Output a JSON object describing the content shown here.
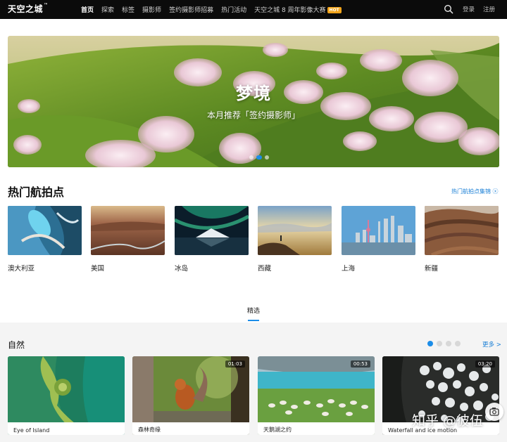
{
  "header": {
    "logo": "天空之城",
    "logo_tm": "™",
    "nav": [
      {
        "label": "首页",
        "active": true
      },
      {
        "label": "探索"
      },
      {
        "label": "标签"
      },
      {
        "label": "摄影师"
      },
      {
        "label": "签约摄影师招募"
      },
      {
        "label": "热门活动"
      },
      {
        "label": "天空之城 8 周年影像大赛",
        "badge": "HOT"
      }
    ],
    "search_icon": "search-icon",
    "login": "登录",
    "register": "注册"
  },
  "banner": {
    "title": "梦境",
    "subtitle": "本月推荐「签约摄影师」",
    "slides": 3,
    "active_slide": 2
  },
  "hot_spots": {
    "title": "热门航拍点",
    "link": "热门航拍点集锦 ⓧ",
    "items": [
      {
        "label": "澳大利亚"
      },
      {
        "label": "美国"
      },
      {
        "label": "冰岛"
      },
      {
        "label": "西藏"
      },
      {
        "label": "上海"
      },
      {
        "label": "新疆"
      }
    ]
  },
  "tabs": {
    "active": "精选"
  },
  "nature": {
    "title": "自然",
    "more": "更多 >",
    "pages": 4,
    "cards": [
      {
        "title": "Eye of Island",
        "duration": ""
      },
      {
        "title": "森林奇缘",
        "duration": "01:03"
      },
      {
        "title": "天鹅湖之约",
        "duration": "00:53"
      },
      {
        "title": "Waterfall and ice motion",
        "duration": "03:20"
      }
    ]
  },
  "watermark": "知乎 @彼伍",
  "colors": {
    "accent": "#1c8de8",
    "hot_badge": "#f2a51c",
    "topbar": "#0b0b0b"
  }
}
